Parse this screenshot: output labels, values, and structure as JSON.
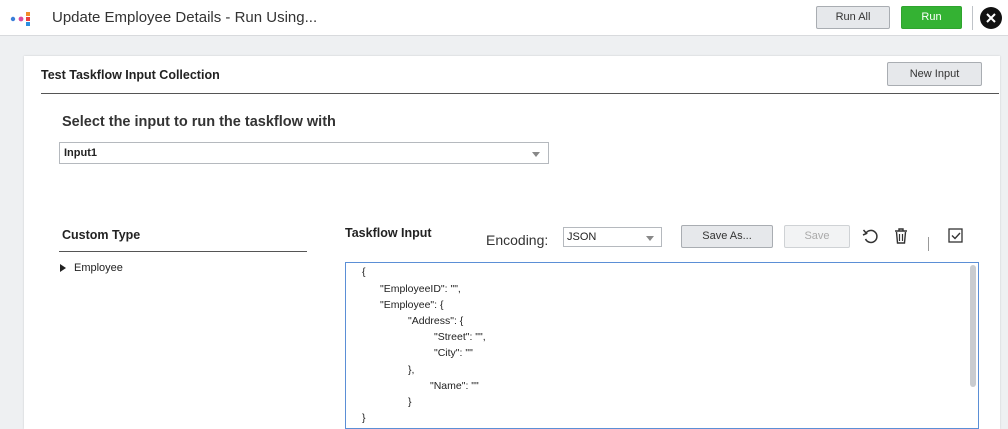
{
  "header": {
    "title": "Update Employee Details - Run Using...",
    "run_all_label": "Run All",
    "run_label": "Run",
    "accent": "#34b233"
  },
  "panel": {
    "title": "Test Taskflow Input Collection",
    "new_input_label": "New Input",
    "select_label": "Select the input to run the taskflow with",
    "selected_input": "Input1"
  },
  "custom_type": {
    "title": "Custom Type",
    "items": [
      {
        "label": "Employee"
      }
    ]
  },
  "taskflow_input": {
    "title": "Taskflow Input",
    "encoding_label": "Encoding:",
    "encoding_value": "JSON",
    "save_as_label": "Save As...",
    "save_label": "Save",
    "editor_lines": [
      "{",
      "\"EmployeeID\": \"\",",
      "\"Employee\": {",
      "\"Address\": {",
      "\"Street\": \"\",",
      "\"City\": \"\"",
      "},",
      "\"Name\": \"\"",
      "}",
      "}"
    ]
  },
  "icons": [
    "logo-icon",
    "close-icon",
    "chevron-down-icon",
    "expand-arrow-icon",
    "undo-icon",
    "trash-icon",
    "checkbox-icon"
  ]
}
